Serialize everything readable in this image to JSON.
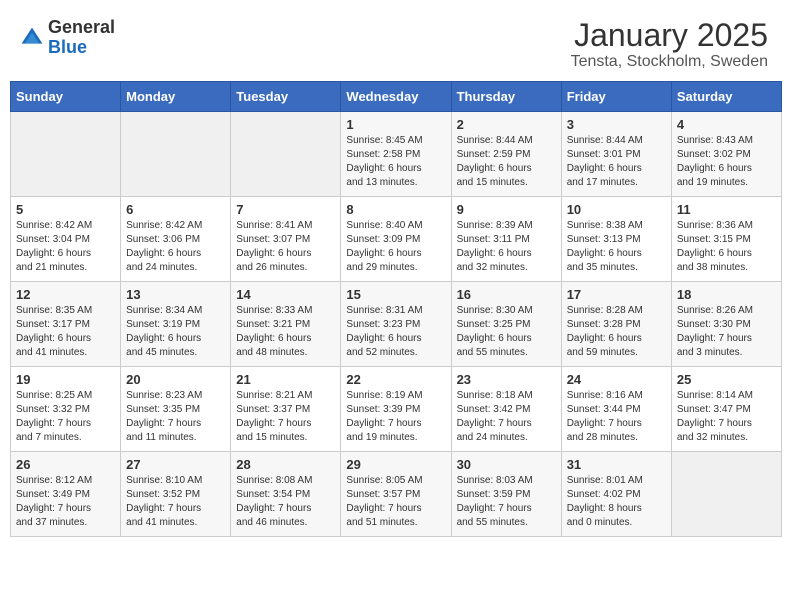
{
  "header": {
    "logo_general": "General",
    "logo_blue": "Blue",
    "month": "January 2025",
    "location": "Tensta, Stockholm, Sweden"
  },
  "weekdays": [
    "Sunday",
    "Monday",
    "Tuesday",
    "Wednesday",
    "Thursday",
    "Friday",
    "Saturday"
  ],
  "weeks": [
    [
      {
        "day": "",
        "info": ""
      },
      {
        "day": "",
        "info": ""
      },
      {
        "day": "",
        "info": ""
      },
      {
        "day": "1",
        "info": "Sunrise: 8:45 AM\nSunset: 2:58 PM\nDaylight: 6 hours\nand 13 minutes."
      },
      {
        "day": "2",
        "info": "Sunrise: 8:44 AM\nSunset: 2:59 PM\nDaylight: 6 hours\nand 15 minutes."
      },
      {
        "day": "3",
        "info": "Sunrise: 8:44 AM\nSunset: 3:01 PM\nDaylight: 6 hours\nand 17 minutes."
      },
      {
        "day": "4",
        "info": "Sunrise: 8:43 AM\nSunset: 3:02 PM\nDaylight: 6 hours\nand 19 minutes."
      }
    ],
    [
      {
        "day": "5",
        "info": "Sunrise: 8:42 AM\nSunset: 3:04 PM\nDaylight: 6 hours\nand 21 minutes."
      },
      {
        "day": "6",
        "info": "Sunrise: 8:42 AM\nSunset: 3:06 PM\nDaylight: 6 hours\nand 24 minutes."
      },
      {
        "day": "7",
        "info": "Sunrise: 8:41 AM\nSunset: 3:07 PM\nDaylight: 6 hours\nand 26 minutes."
      },
      {
        "day": "8",
        "info": "Sunrise: 8:40 AM\nSunset: 3:09 PM\nDaylight: 6 hours\nand 29 minutes."
      },
      {
        "day": "9",
        "info": "Sunrise: 8:39 AM\nSunset: 3:11 PM\nDaylight: 6 hours\nand 32 minutes."
      },
      {
        "day": "10",
        "info": "Sunrise: 8:38 AM\nSunset: 3:13 PM\nDaylight: 6 hours\nand 35 minutes."
      },
      {
        "day": "11",
        "info": "Sunrise: 8:36 AM\nSunset: 3:15 PM\nDaylight: 6 hours\nand 38 minutes."
      }
    ],
    [
      {
        "day": "12",
        "info": "Sunrise: 8:35 AM\nSunset: 3:17 PM\nDaylight: 6 hours\nand 41 minutes."
      },
      {
        "day": "13",
        "info": "Sunrise: 8:34 AM\nSunset: 3:19 PM\nDaylight: 6 hours\nand 45 minutes."
      },
      {
        "day": "14",
        "info": "Sunrise: 8:33 AM\nSunset: 3:21 PM\nDaylight: 6 hours\nand 48 minutes."
      },
      {
        "day": "15",
        "info": "Sunrise: 8:31 AM\nSunset: 3:23 PM\nDaylight: 6 hours\nand 52 minutes."
      },
      {
        "day": "16",
        "info": "Sunrise: 8:30 AM\nSunset: 3:25 PM\nDaylight: 6 hours\nand 55 minutes."
      },
      {
        "day": "17",
        "info": "Sunrise: 8:28 AM\nSunset: 3:28 PM\nDaylight: 6 hours\nand 59 minutes."
      },
      {
        "day": "18",
        "info": "Sunrise: 8:26 AM\nSunset: 3:30 PM\nDaylight: 7 hours\nand 3 minutes."
      }
    ],
    [
      {
        "day": "19",
        "info": "Sunrise: 8:25 AM\nSunset: 3:32 PM\nDaylight: 7 hours\nand 7 minutes."
      },
      {
        "day": "20",
        "info": "Sunrise: 8:23 AM\nSunset: 3:35 PM\nDaylight: 7 hours\nand 11 minutes."
      },
      {
        "day": "21",
        "info": "Sunrise: 8:21 AM\nSunset: 3:37 PM\nDaylight: 7 hours\nand 15 minutes."
      },
      {
        "day": "22",
        "info": "Sunrise: 8:19 AM\nSunset: 3:39 PM\nDaylight: 7 hours\nand 19 minutes."
      },
      {
        "day": "23",
        "info": "Sunrise: 8:18 AM\nSunset: 3:42 PM\nDaylight: 7 hours\nand 24 minutes."
      },
      {
        "day": "24",
        "info": "Sunrise: 8:16 AM\nSunset: 3:44 PM\nDaylight: 7 hours\nand 28 minutes."
      },
      {
        "day": "25",
        "info": "Sunrise: 8:14 AM\nSunset: 3:47 PM\nDaylight: 7 hours\nand 32 minutes."
      }
    ],
    [
      {
        "day": "26",
        "info": "Sunrise: 8:12 AM\nSunset: 3:49 PM\nDaylight: 7 hours\nand 37 minutes."
      },
      {
        "day": "27",
        "info": "Sunrise: 8:10 AM\nSunset: 3:52 PM\nDaylight: 7 hours\nand 41 minutes."
      },
      {
        "day": "28",
        "info": "Sunrise: 8:08 AM\nSunset: 3:54 PM\nDaylight: 7 hours\nand 46 minutes."
      },
      {
        "day": "29",
        "info": "Sunrise: 8:05 AM\nSunset: 3:57 PM\nDaylight: 7 hours\nand 51 minutes."
      },
      {
        "day": "30",
        "info": "Sunrise: 8:03 AM\nSunset: 3:59 PM\nDaylight: 7 hours\nand 55 minutes."
      },
      {
        "day": "31",
        "info": "Sunrise: 8:01 AM\nSunset: 4:02 PM\nDaylight: 8 hours\nand 0 minutes."
      },
      {
        "day": "",
        "info": ""
      }
    ]
  ]
}
